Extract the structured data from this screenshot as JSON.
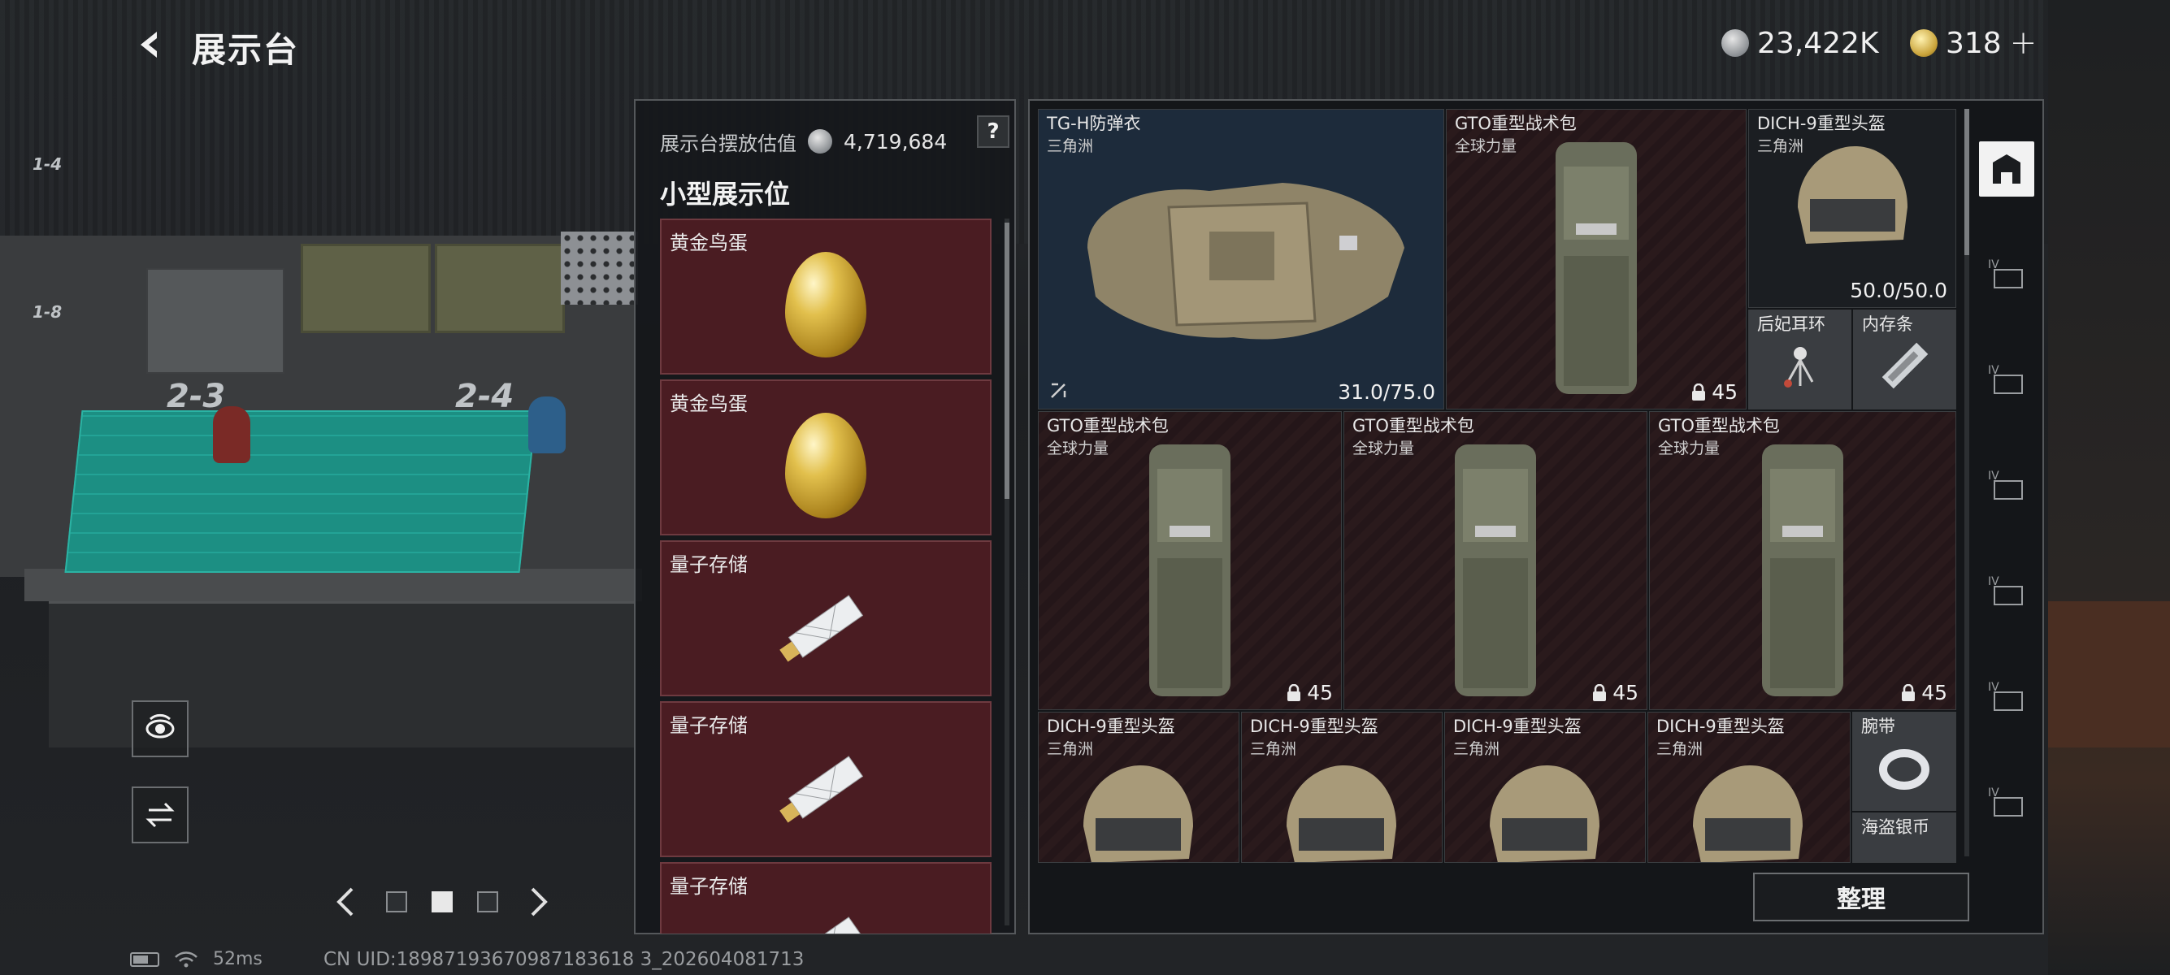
{
  "header": {
    "title": "展示台",
    "currency_silver": "23,422K",
    "currency_gold": "318",
    "add_label": "+"
  },
  "scene": {
    "mat_label_1": "2-3",
    "mat_label_2": "2-4",
    "shelf_label_1": "1-4",
    "shelf_label_2": "1-8"
  },
  "list_panel": {
    "estimate_label": "展示台摆放估值",
    "estimate_value": "4,719,684",
    "help_label": "?",
    "section_title": "小型展示位",
    "slots": [
      {
        "name": "黄金鸟蛋",
        "icon": "golden-egg-icon"
      },
      {
        "name": "黄金鸟蛋",
        "icon": "golden-egg-icon"
      },
      {
        "name": "量子存储",
        "icon": "quantum-storage-icon"
      },
      {
        "name": "量子存储",
        "icon": "quantum-storage-icon"
      },
      {
        "name": "量子存储",
        "icon": "quantum-storage-icon"
      }
    ]
  },
  "inventory": {
    "items": [
      {
        "name": "TG-H防弹衣",
        "sub": "三角洲",
        "value": "31.0/75.0"
      },
      {
        "name": "GTO重型战术包",
        "sub": "全球力量",
        "value": "45"
      },
      {
        "name": "DICH-9重型头盔",
        "sub": "三角洲",
        "value": "50.0/50.0"
      },
      {
        "name": "后妃耳环",
        "sub": ""
      },
      {
        "name": "内存条",
        "sub": ""
      },
      {
        "name": "GTO重型战术包",
        "sub": "全球力量",
        "value": "45"
      },
      {
        "name": "GTO重型战术包",
        "sub": "全球力量",
        "value": "45"
      },
      {
        "name": "GTO重型战术包",
        "sub": "全球力量",
        "value": "45"
      },
      {
        "name": "DICH-9重型头盔",
        "sub": "三角洲"
      },
      {
        "name": "DICH-9重型头盔",
        "sub": "三角洲"
      },
      {
        "name": "DICH-9重型头盔",
        "sub": "三角洲"
      },
      {
        "name": "DICH-9重型头盔",
        "sub": "三角洲"
      },
      {
        "name": "腕带",
        "sub": ""
      },
      {
        "name": "海盗银币",
        "sub": ""
      }
    ],
    "sort_label": "整理",
    "categories": [
      "all-icon",
      "armor-tier-iv-icon",
      "armor-tier-iv-icon",
      "armor-tier-iv-icon",
      "armor-tier-iv-icon",
      "armor-tier-iv-icon",
      "armor-tier-iv-icon"
    ]
  },
  "status": {
    "ping": "52ms",
    "uid": "CN UID:18987193670987183618 3_202604081713"
  },
  "colors": {
    "slot_bg": "#4a1c22",
    "gold": "#c9a33a",
    "mat": "#1c8f83"
  }
}
